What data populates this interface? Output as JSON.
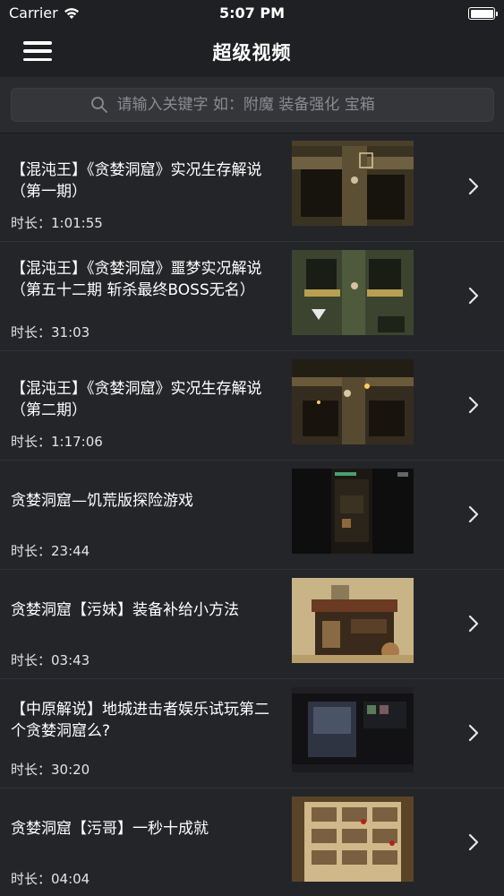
{
  "status_bar": {
    "carrier": "Carrier",
    "time": "5:07 PM"
  },
  "nav": {
    "title": "超级视频"
  },
  "search": {
    "placeholder": "请输入关键字 如：附魔 装备强化 宝箱"
  },
  "duration_prefix": "时长：",
  "videos": [
    {
      "title": "【混沌王】《贪婪洞窟》实况生存解说（第一期）",
      "duration": "时长：1:01:55"
    },
    {
      "title": "【混沌王】《贪婪洞窟》噩梦实况解说（第五十二期 斩杀最终BOSS无名）",
      "duration": "时长：31:03"
    },
    {
      "title": "【混沌王】《贪婪洞窟》实况生存解说（第二期）",
      "duration": "时长：1:17:06"
    },
    {
      "title": "贪婪洞窟—饥荒版探险游戏",
      "duration": "时长：23:44"
    },
    {
      "title": "贪婪洞窟【污妹】装备补给小方法",
      "duration": "时长：03:43"
    },
    {
      "title": "【中原解说】地城进击者娱乐试玩第二个贪婪洞窟么?",
      "duration": "时长：30:20"
    },
    {
      "title": "贪婪洞窟【污哥】一秒十成就",
      "duration": "时长：04:04"
    }
  ],
  "colors": {
    "background": "#242529",
    "bar": "#1f2023",
    "text": "#ffffff",
    "placeholder": "#8a8b90"
  }
}
